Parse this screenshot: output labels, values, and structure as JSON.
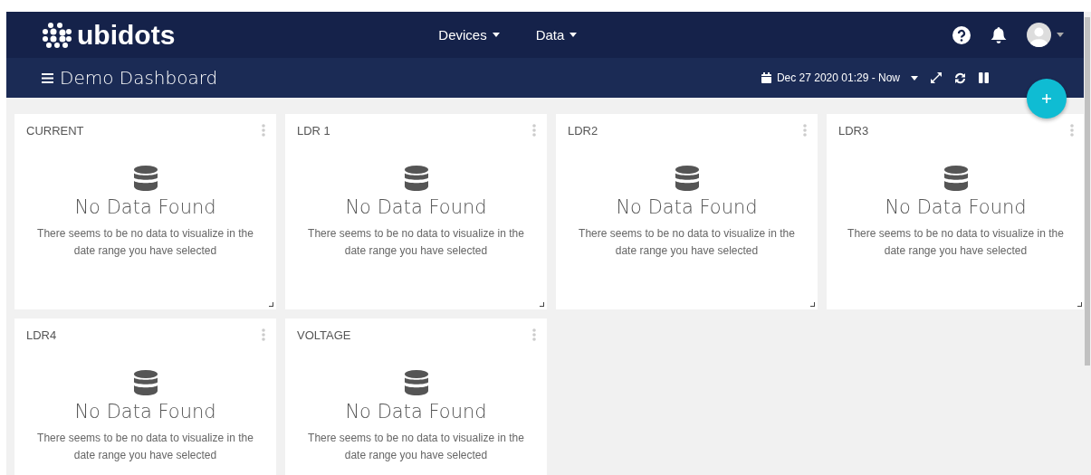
{
  "navbar": {
    "brand": "ubidots",
    "menus": [
      {
        "label": "Devices"
      },
      {
        "label": "Data"
      }
    ]
  },
  "dashboard_bar": {
    "title": "Demo Dashboard",
    "date_range": "Dec 27 2020 01:29 - Now"
  },
  "widgets": [
    {
      "title": "CURRENT",
      "message": "No Data Found",
      "detail": "There seems to be no data to visualize in the date range you have selected"
    },
    {
      "title": "LDR 1",
      "message": "No Data Found",
      "detail": "There seems to be no data to visualize in the date range you have selected"
    },
    {
      "title": "LDR2",
      "message": "No Data Found",
      "detail": "There seems to be no data to visualize in the date range you have selected"
    },
    {
      "title": "LDR3",
      "message": "No Data Found",
      "detail": "There seems to be no data to visualize in the date range you have selected"
    },
    {
      "title": "LDR4",
      "message": "No Data Found",
      "detail": "There seems to be no data to visualize in the date range you have selected"
    },
    {
      "title": "VOLTAGE",
      "message": "No Data Found",
      "detail": "There seems to be no data to visualize in the date range you have selected"
    }
  ]
}
